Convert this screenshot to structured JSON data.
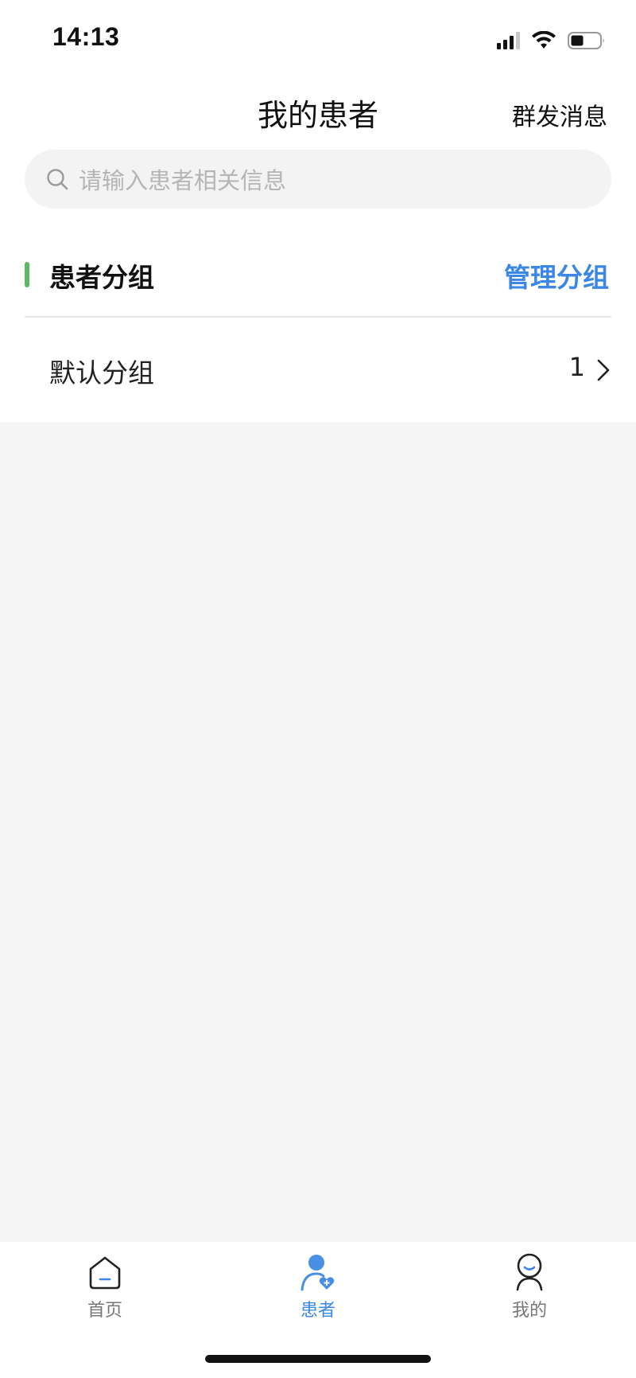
{
  "status_bar": {
    "time": "14:13"
  },
  "nav": {
    "title": "我的患者",
    "action_label": "群发消息"
  },
  "search": {
    "placeholder": "请输入患者相关信息"
  },
  "section": {
    "title": "患者分组",
    "action_label": "管理分组",
    "accent_color": "#5cb862",
    "action_color": "#3c87e6"
  },
  "groups": [
    {
      "label": "默认分组",
      "count": "1"
    }
  ],
  "tabbar": {
    "items": [
      {
        "label": "首页",
        "icon": "home-icon",
        "active": false
      },
      {
        "label": "患者",
        "icon": "patient-icon",
        "active": true
      },
      {
        "label": "我的",
        "icon": "profile-icon",
        "active": false
      }
    ],
    "active_color": "#3c87e6"
  }
}
